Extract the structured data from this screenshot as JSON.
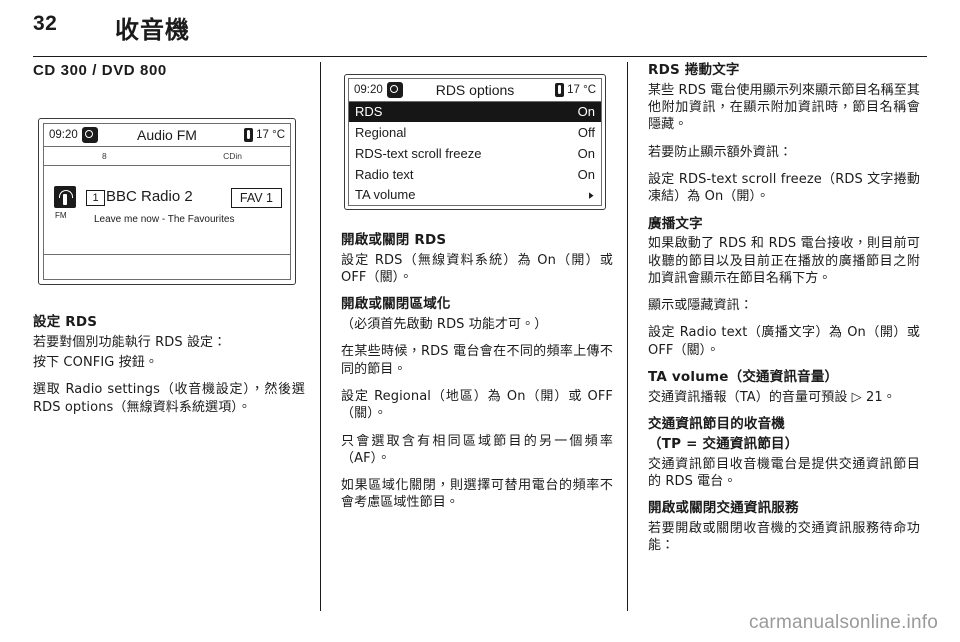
{
  "page": {
    "number": "32",
    "chapter": "收音機"
  },
  "watermark": "carmanualsonline.info",
  "col1": {
    "section_title": "CD 300 / DVD 800",
    "radio_screen": {
      "clock": "09:20",
      "clock_icon": "clock-badge-icon",
      "title": "Audio FM",
      "temperature": "17 °C",
      "thermo_icon": "thermometer-icon",
      "sub_left": "8",
      "sub_right": "CDin",
      "band_icon": "fm-antenna-icon",
      "band_label": "FM",
      "preset_number": "1",
      "station_name": "BBC Radio 2",
      "track_info": "Leave me now - The Favourites",
      "fav_label": "FAV 1"
    },
    "heading_1": "設定 RDS",
    "para_1": "若要對個別功能執行 RDS 設定：",
    "para_2": "按下 CONFIG 按鈕。",
    "para_3": "選取 Radio settings（收音機設定），然後選 RDS options（無線資料系統選項）。"
  },
  "col2": {
    "rds_screen": {
      "clock": "09:20",
      "clock_icon": "clock-badge-icon",
      "title": "RDS options",
      "temperature": "17 °C",
      "thermo_icon": "thermometer-icon",
      "rows": [
        {
          "label": "RDS",
          "value": "On",
          "selected": true,
          "arrow": false
        },
        {
          "label": "Regional",
          "value": "Off",
          "selected": false,
          "arrow": false
        },
        {
          "label": "RDS-text scroll freeze",
          "value": "On",
          "selected": false,
          "arrow": false
        },
        {
          "label": "Radio text",
          "value": "On",
          "selected": false,
          "arrow": false
        },
        {
          "label": "TA volume",
          "value": "",
          "selected": false,
          "arrow": true
        }
      ],
      "arrow_glyph": "▸"
    },
    "heading_1": "開啟或關閉 RDS",
    "para_1": "設定 RDS（無線資料系統）為 On（開）或 OFF（關）。",
    "heading_2": "開啟或關閉區域化",
    "para_2": "（必須首先啟動 RDS 功能才可。）",
    "para_3": "在某些時候，RDS 電台會在不同的頻率上傳不同的節目。",
    "para_4": "設定 Regional（地區）為 On（開）或 OFF（關）。",
    "para_5": "只會選取含有相同區域節目的另一個頻率（AF）。",
    "para_6": "如果區域化關閉，則選擇可替用電台的頻率不會考慮區域性節目。"
  },
  "col3": {
    "heading_1": "RDS 捲動文字",
    "para_1": "某些 RDS 電台使用顯示列來顯示節目名稱至其他附加資訊，在顯示附加資訊時，節目名稱會隱藏。",
    "para_2": "若要防止顯示額外資訊：",
    "para_3": "設定 RDS-text scroll freeze（RDS 文字捲動凍結）為 On（開）。",
    "heading_2": "廣播文字",
    "para_4": "如果啟動了 RDS 和 RDS 電台接收，則目前可收聽的節目以及目前正在播放的廣播節目之附加資訊會顯示在節目名稱下方。",
    "para_5": "顯示或隱藏資訊：",
    "para_6": "設定 Radio text（廣播文字）為 On（開）或 OFF（關）。",
    "heading_3": "TA volume（交通資訊音量）",
    "para_7": "交通資訊播報（TA）的音量可預設 ▷ 21。",
    "heading_4": "交通資訊節目的收音機",
    "heading_4b": "（TP = 交通資訊節目）",
    "para_8": "交通資訊節目收音機電台是提供交通資訊節目的 RDS 電台。",
    "heading_5": "開啟或關閉交通資訊服務",
    "para_9": "若要開啟或關閉收音機的交通資訊服務待命功能："
  }
}
